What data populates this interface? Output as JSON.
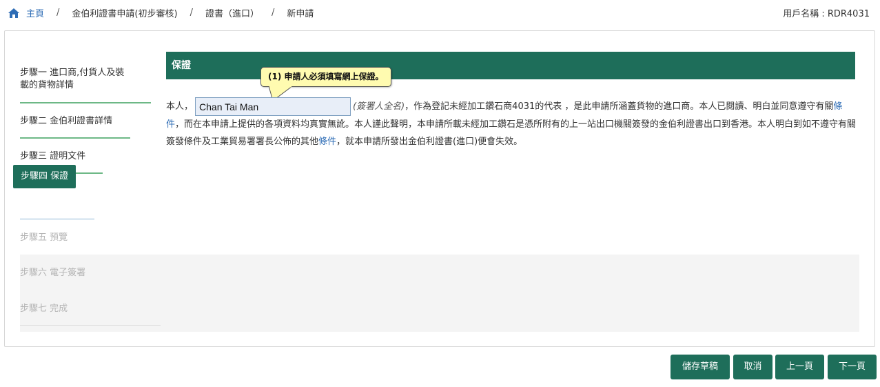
{
  "breadcrumb": {
    "home_icon": "home-icon",
    "items": [
      "主頁",
      "金伯利證書申請(初步審核)",
      "證書（進口）",
      "新申請"
    ],
    "separator": "/"
  },
  "user": {
    "label": "用戶名稱 : RDR4031"
  },
  "sidebar": {
    "steps": [
      {
        "line1": "步驟一 進口商,付貨人及裝",
        "line2": "載的貨物詳情",
        "state": "done"
      },
      {
        "label": "步驟二 金伯利證書詳情",
        "state": "done"
      },
      {
        "label": "步驟三 證明文件",
        "state": "done"
      },
      {
        "label": "步驟四 保證",
        "state": "active"
      },
      {
        "label": "步驟五 預覽",
        "state": "disabled"
      },
      {
        "label": "步驟六 電子簽署",
        "state": "disabled"
      },
      {
        "label": "步驟七 完成",
        "state": "disabled"
      }
    ]
  },
  "section": {
    "title": "保證",
    "tooltip": "(1) 申請人必須填寫網上保證。",
    "declaration": {
      "prefix": "本人，",
      "name_value": "Chan Tai Man",
      "name_hint": "(簽署人全名)",
      "text1": "，作為登記未經加工鑽石商4031的代表 ，是此申請所涵蓋貨物的進口商。本人已閱讀、明白並同意遵守有關",
      "link1": "條件",
      "text2": "，而在本申請上提供的各項資料均真實無訛。本人謹此聲明，本申請所載未經加工鑽石是憑所附有的上一站出口機關簽發的金伯利證書出口到香港。本人明白到如不遵守有關簽發條件及工業貿易署署長公佈的其他",
      "link2": "條件",
      "text3": "，就本申請所發出金伯利證書(進口)便會失效。"
    }
  },
  "buttons": {
    "save_draft": "儲存草稿",
    "cancel": "取消",
    "prev": "上一頁",
    "next": "下一頁"
  },
  "colors": {
    "primary": "#1e6e5a",
    "link": "#2d6cb5",
    "tooltip_bg": "#fffbb0",
    "step_underline": "#6db886",
    "disabled_text": "#b5b5b5"
  }
}
